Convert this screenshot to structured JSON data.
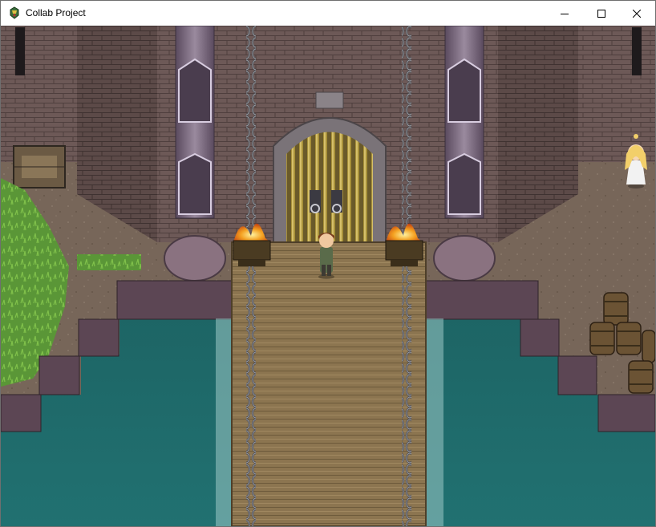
{
  "window": {
    "title": "Collab Project",
    "icon": "rpg-maker-icon",
    "controls": {
      "minimize": "minimize-icon",
      "maximize": "maximize-icon",
      "close": "close-icon"
    }
  },
  "scene": {
    "type": "castle-gate-drawbridge",
    "palette": {
      "water": "#1f6a6a",
      "brick": "#6e5a5a",
      "bridge": "#8f7850",
      "grass": "#5f9a3a",
      "ground": "#7a6a5e",
      "fire": "#f4a020"
    }
  }
}
